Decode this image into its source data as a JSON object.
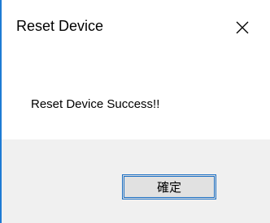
{
  "dialog": {
    "title": "Reset Device",
    "close_icon": "close-icon",
    "message": "Reset Device Success!!",
    "ok_label": "確定"
  },
  "colors": {
    "dialog_bg": "#ffffff",
    "button_area_bg": "#f0f0f0",
    "button_bg": "#e1e1e1",
    "focus_border": "#1b6fc4",
    "left_edge": "#1e7bd4"
  }
}
